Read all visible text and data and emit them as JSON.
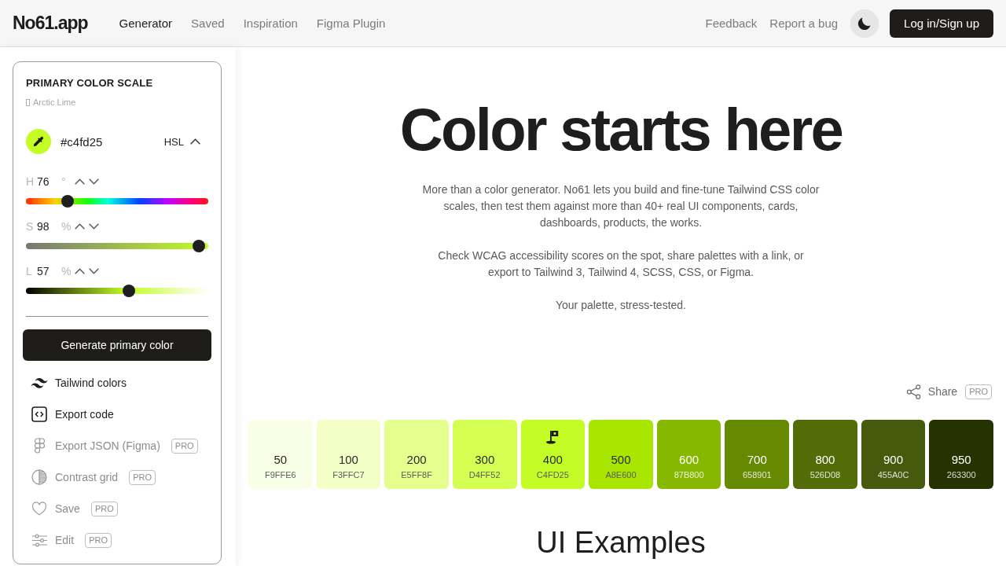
{
  "header": {
    "logo": "No61.app",
    "nav": [
      {
        "label": "Generator",
        "selected": true
      },
      {
        "label": "Saved",
        "selected": false
      },
      {
        "label": "Inspiration",
        "selected": false
      },
      {
        "label": "Figma Plugin",
        "selected": false
      }
    ],
    "links": [
      "Feedback",
      "Report a bug"
    ],
    "login_button": "Log in/Sign up"
  },
  "sidebar": {
    "title": "PRIMARY COLOR SCALE",
    "palette_name": "Arctic Lime",
    "picker": {
      "color": "#c4fd25",
      "hex": "#c4fd25",
      "mode": "HSL"
    },
    "channels": [
      {
        "kind": "hue",
        "letter": "H",
        "value": "76",
        "unit": "°",
        "level": 0.21
      },
      {
        "kind": "saturation",
        "letter": "S",
        "value": "98",
        "unit": "%",
        "level": 0.98
      },
      {
        "kind": "lightness",
        "letter": "L",
        "value": "57",
        "unit": "%",
        "level": 0.57
      }
    ],
    "generate_button": "Generate primary color",
    "menu": [
      {
        "label": "Tailwind colors",
        "disabled": false
      },
      {
        "label": "Export code",
        "disabled": false
      },
      {
        "label": "Export JSON (Figma)",
        "disabled": true,
        "badge": "PRO"
      },
      {
        "label": "Contrast grid",
        "disabled": true,
        "badge": "PRO"
      },
      {
        "label": "Save",
        "disabled": true,
        "badge": "PRO"
      },
      {
        "label": "Edit",
        "disabled": true,
        "badge": "PRO"
      }
    ]
  },
  "main": {
    "title": "Color starts here",
    "paragraphs": [
      "More than a color generator. No61 lets you build and fine-tune Tailwind CSS color scales, then test them against more than 40+ real UI components, cards, dashboards, products, the works.",
      "Check WCAG accessibility scores on the spot, share palettes with a link, or export to Tailwind 3, Tailwind 4, SCSS, CSS, or Figma.",
      "Your palette, stress-tested."
    ],
    "share": {
      "label": "Share",
      "badge": "PRO"
    },
    "swatches": [
      {
        "shade": "50",
        "hex": "F9FFE6",
        "color": "#f9ffe6",
        "selected": false
      },
      {
        "shade": "100",
        "hex": "F3FFC7",
        "color": "#f3ffc7",
        "selected": false
      },
      {
        "shade": "200",
        "hex": "E5FF8F",
        "color": "#e5ff8f",
        "selected": false
      },
      {
        "shade": "300",
        "hex": "D4FF52",
        "color": "#d4ff52",
        "selected": false
      },
      {
        "shade": "400",
        "hex": "C4FD25",
        "color": "#c4fd25",
        "selected": true
      },
      {
        "shade": "500",
        "hex": "A8E600",
        "color": "#a8e600",
        "selected": false
      },
      {
        "shade": "600",
        "hex": "87B800",
        "color": "#87b800",
        "selected": false
      },
      {
        "shade": "700",
        "hex": "658901",
        "color": "#658901",
        "selected": false
      },
      {
        "shade": "800",
        "hex": "526D08",
        "color": "#526d08",
        "selected": false
      },
      {
        "shade": "900",
        "hex": "455A0C",
        "color": "#455a0c",
        "selected": false
      },
      {
        "shade": "950",
        "hex": "263300",
        "color": "#263300",
        "selected": false
      }
    ],
    "section_title": "UI Examples"
  }
}
